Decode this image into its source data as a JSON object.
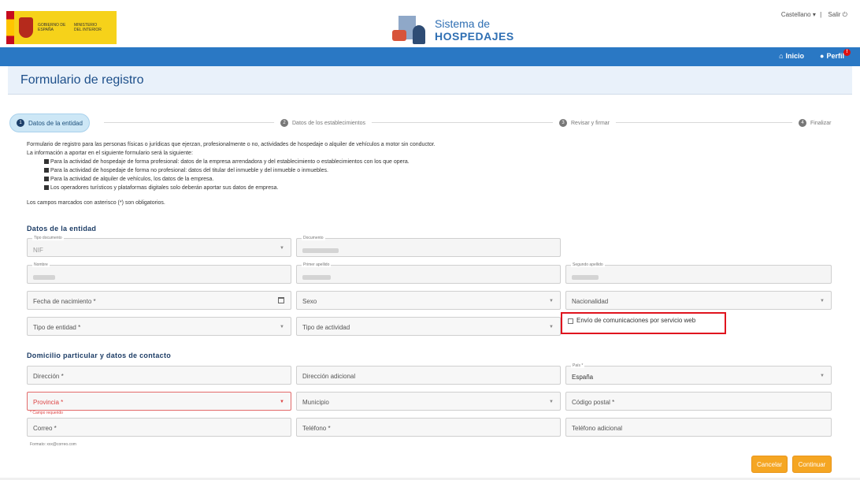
{
  "header": {
    "gov_text_1": "GOBIERNO DE ESPAÑA",
    "gov_text_2": "MINISTERIO DEL INTERIOR",
    "app_name_line1": "Sistema de",
    "app_name_line2": "HOSPEDAJES",
    "language": "Castellano",
    "logout": "Salir"
  },
  "nav": {
    "home": "Inicio",
    "profile": "Perfil",
    "badge": "!"
  },
  "page_title": "Formulario de registro",
  "steps": [
    {
      "num": "1",
      "label": "Datos de la entidad",
      "active": true
    },
    {
      "num": "2",
      "label": "Datos de los establecimientos",
      "active": false
    },
    {
      "num": "3",
      "label": "Revisar y firmar",
      "active": false
    },
    {
      "num": "4",
      "label": "Finalizar",
      "active": false
    }
  ],
  "intro": {
    "line1": "Formulario de registro para las personas físicas o jurídicas que ejerzan, profesionalmente o no, actividades de hospedaje o alquiler de vehículos a motor sin conductor.",
    "line2": "La información a aportar en el siguiente formulario será la siguiente:",
    "bullets": [
      "Para la actividad de hospedaje de forma profesional: datos de la empresa arrendadora y del establecimiento o establecimientos con los que opera.",
      "Para la actividad de hospedaje de forma no profesional: datos del titular del inmueble y del inmueble o inmuebles.",
      "Para la actividad de alquiler de vehículos, los datos de la empresa.",
      "Los operadores turísticos y plataformas digitales solo deberán aportar sus datos de empresa."
    ],
    "required_note": "Los campos marcados con asterisco (*) son obligatorios."
  },
  "section_entity": {
    "title": "Datos de la entidad",
    "tipo_documento_label": "Tipo documento",
    "tipo_documento_value": "NIF",
    "documento_label": "Documento",
    "nombre_label": "Nombre",
    "primer_apellido_label": "Primer apellido",
    "segundo_apellido_label": "Segundo apellido",
    "fecha_nacimiento": "Fecha de nacimiento *",
    "sexo": "Sexo",
    "nacionalidad": "Nacionalidad",
    "tipo_entidad": "Tipo de entidad *",
    "tipo_actividad": "Tipo de actividad",
    "envio_web": "Envío de comunicaciones por servicio web"
  },
  "section_address": {
    "title": "Domicilio particular y datos de contacto",
    "direccion": "Dirección *",
    "direccion_adicional": "Dirección adicional",
    "pais_label": "País *",
    "pais_value": "España",
    "provincia": "Provincia *",
    "provincia_error": "* Campo requerido",
    "municipio": "Municipio",
    "codigo_postal": "Código postal *",
    "correo": "Correo *",
    "correo_hint": "Formato: xxx@correo.com",
    "telefono": "Teléfono *",
    "telefono_adicional": "Teléfono adicional"
  },
  "actions": {
    "cancel": "Cancelar",
    "continue": "Continuar"
  },
  "colors": {
    "nav_blue": "#2a78c4",
    "accent_orange": "#f5a623",
    "highlight_red": "#e0141e"
  }
}
